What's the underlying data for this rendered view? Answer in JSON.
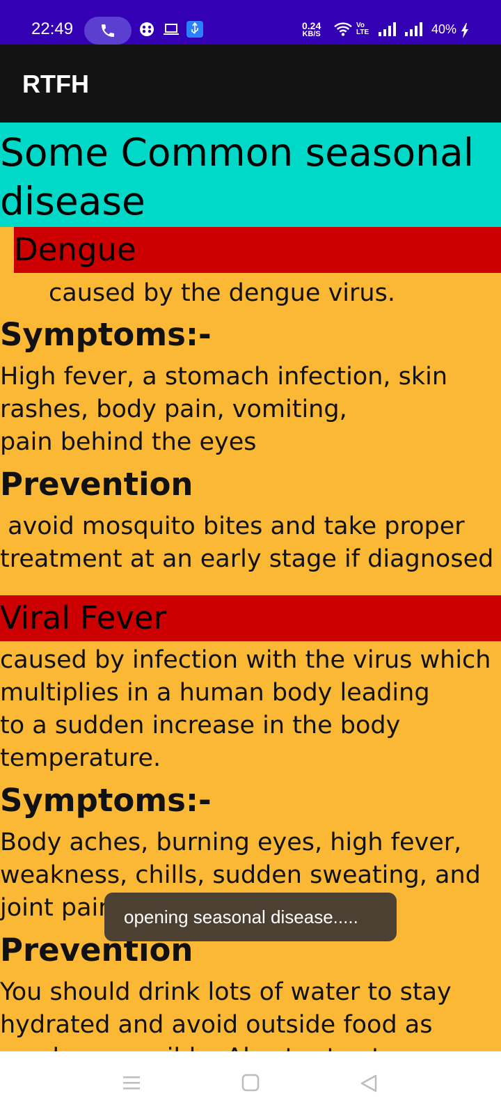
{
  "status_bar": {
    "time": "22:49",
    "net_speed_value": "0.24",
    "net_speed_unit": "KB/S",
    "volte_label": "Vo LTE",
    "battery": "40%",
    "colors": {
      "background": "#3300b4"
    }
  },
  "app_bar": {
    "title": "RTFH",
    "background": "#131313"
  },
  "content": {
    "heading": "Some Common seasonal disease",
    "diseases": [
      {
        "name": "Dengue",
        "cause": "caused by the dengue virus.",
        "symptoms_label": "Symptoms:-",
        "symptoms": "High fever, a stomach infection, skin rashes, body pain, vomiting,\npain behind the eyes",
        "prevention_label": "Prevention",
        "prevention": " avoid mosquito bites and take proper treatment at an early stage if diagnosed"
      },
      {
        "name": "Viral Fever",
        "cause": "caused by infection with the virus which multiplies in a human body leading\nto a sudden increase in the body temperature.",
        "symptoms_label": "Symptoms:-",
        "symptoms": "Body aches, burning eyes, high fever, weakness, chills, sudden sweating, and joint pain",
        "prevention_label": "Prevention",
        "prevention": "You should drink lots of water to stay hydrated and avoid outside food as much as possible. Also try to stay"
      }
    ],
    "colors": {
      "heading_bg": "#00d9c8",
      "disease_bg": "#cc0000",
      "page_bg": "#fbb835"
    }
  },
  "toast": {
    "message": "opening seasonal disease....."
  },
  "nav_bar": {
    "icons": [
      "menu-icon",
      "home-square-icon",
      "back-triangle-icon"
    ]
  }
}
